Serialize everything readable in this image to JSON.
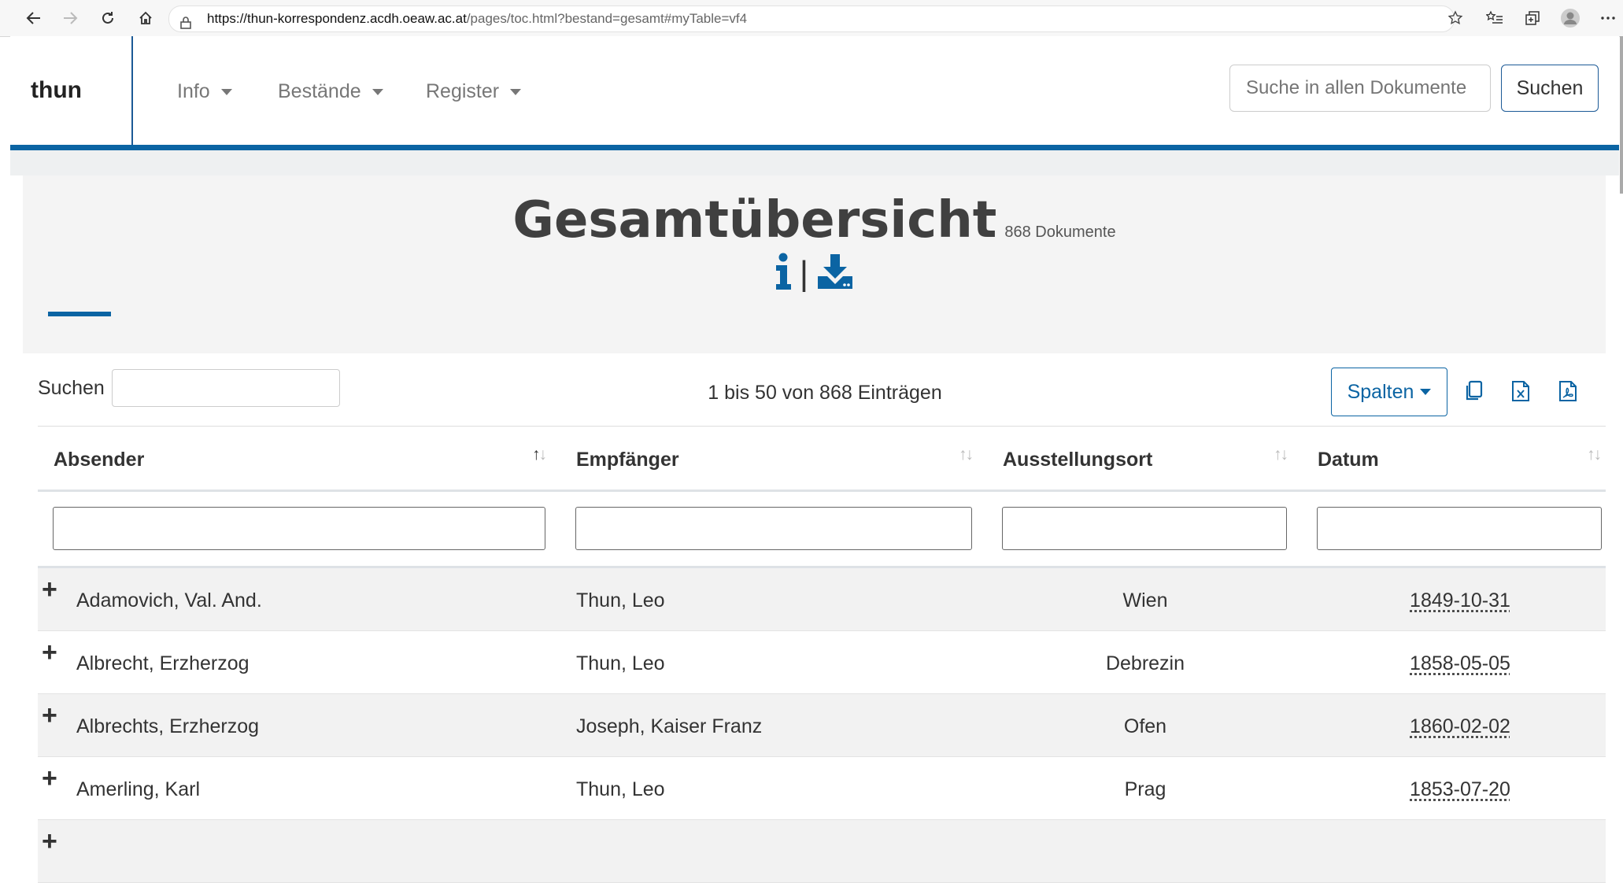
{
  "browser": {
    "url_host": "https://thun-korrespondenz.acdh.oeaw.ac.at",
    "url_path": "/pages/toc.html?bestand=gesamt#myTable=vf4"
  },
  "navbar": {
    "brand": "thun",
    "items": [
      {
        "label": "Info"
      },
      {
        "label": "Bestände"
      },
      {
        "label": "Register"
      }
    ],
    "search_placeholder": "Suche in allen Dokumente",
    "search_button": "Suchen"
  },
  "header": {
    "title": "Gesamtübersicht",
    "subtitle": "868 Dokumente",
    "separator": "|"
  },
  "controls": {
    "search_label": "Suchen",
    "info": "1 bis 50 von 868 Einträgen",
    "columns_button": "Spalten"
  },
  "table": {
    "columns": [
      "Absender",
      "Empfänger",
      "Ausstellungsort",
      "Datum"
    ],
    "rows": [
      {
        "absender": "Adamovich, Val. And.",
        "empfaenger": "Thun, Leo",
        "ort": "Wien",
        "datum": "1849-10-31"
      },
      {
        "absender": "Albrecht, Erzherzog",
        "empfaenger": "Thun, Leo",
        "ort": "Debrezin",
        "datum": "1858-05-05"
      },
      {
        "absender": "Albrechts, Erzherzog",
        "empfaenger": "Joseph, Kaiser Franz",
        "ort": "Ofen",
        "datum": "1860-02-02"
      },
      {
        "absender": "Amerling, Karl",
        "empfaenger": "Thun, Leo",
        "ort": "Prag",
        "datum": "1853-07-20"
      }
    ]
  },
  "colors": {
    "accent": "#0b64a3",
    "row_striped": "#f2f2f2"
  }
}
